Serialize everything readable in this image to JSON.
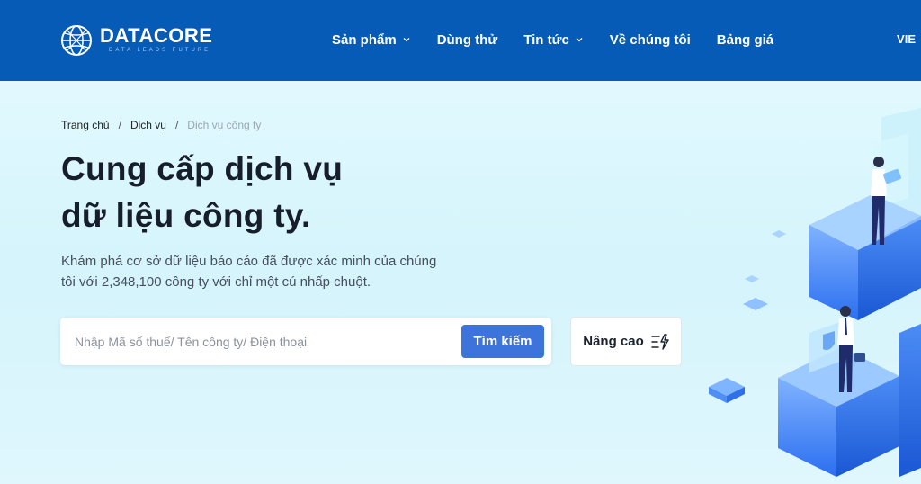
{
  "brand": {
    "name": "DATACORE",
    "tagline": "DATA LEADS FUTURE"
  },
  "nav": {
    "items": [
      {
        "label": "Sản phẩm",
        "dropdown": true
      },
      {
        "label": "Dùng thử",
        "dropdown": false
      },
      {
        "label": "Tin tức",
        "dropdown": true
      },
      {
        "label": "Về chúng tôi",
        "dropdown": false
      },
      {
        "label": "Bảng giá",
        "dropdown": false
      }
    ],
    "language": "VIE"
  },
  "breadcrumb": {
    "home": "Trang chủ",
    "services": "Dịch vụ",
    "current": "Dịch vụ công ty",
    "separator": "/"
  },
  "hero": {
    "title_line1": "Cung cấp dịch vụ",
    "title_line2": "dữ liệu công ty.",
    "description_line1": "Khám phá cơ sở dữ liệu báo cáo đã được xác minh của chúng",
    "description_line2": "tôi với 2,348,100 công ty với chỉ một cú nhấp chuột."
  },
  "search": {
    "placeholder": "Nhập Mã số thuế/ Tên công ty/ Điện thoại",
    "value": "",
    "button_label": "Tìm kiếm",
    "advanced_label": "Nâng cao"
  },
  "colors": {
    "header_bg": "#055bb5",
    "accent": "#3d74dc",
    "title": "#161d2b"
  }
}
